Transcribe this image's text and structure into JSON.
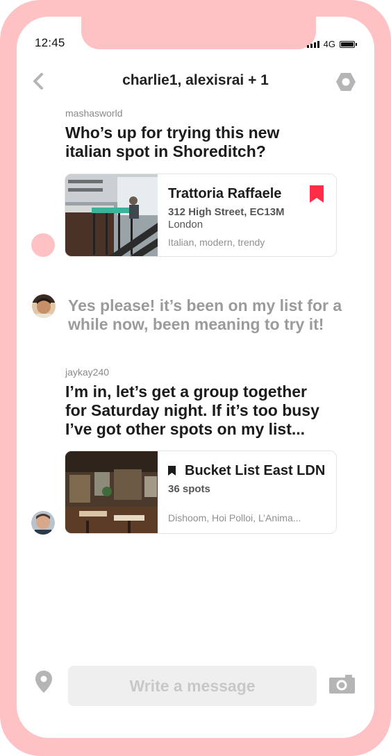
{
  "status_bar": {
    "time": "12:45",
    "network": "4G"
  },
  "header": {
    "title": "charlie1, alexisrai + 1"
  },
  "messages": [
    {
      "username": "mashasworld",
      "text_line1": "Who’s up for trying this new",
      "text_line2": "italian spot in Shoreditch?"
    },
    {
      "text_line1": "Yes please! it’s been on my list for a",
      "text_line2": "while now, been meaning to try it!"
    },
    {
      "username": "jaykay240",
      "text_line1": "I’m in, let’s get a group together",
      "text_line2": "for Saturday night. If it’s too busy",
      "text_line3": "I’ve got other spots on my list..."
    }
  ],
  "restaurant_card": {
    "name": "Trattoria Raffaele",
    "address": "312 High Street, EC13M",
    "city": "London",
    "tags": "Italian, modern, trendy",
    "bookmark_color": "#ff2d46"
  },
  "list_card": {
    "title": "Bucket List East LDN",
    "count": "36 spots",
    "spots": "Dishoom, Hoi Polloi, L’Anima..."
  },
  "composer": {
    "placeholder": "Write a message"
  },
  "colors": {
    "frame": "#ffc2c4",
    "accent": "#ff2d46"
  }
}
